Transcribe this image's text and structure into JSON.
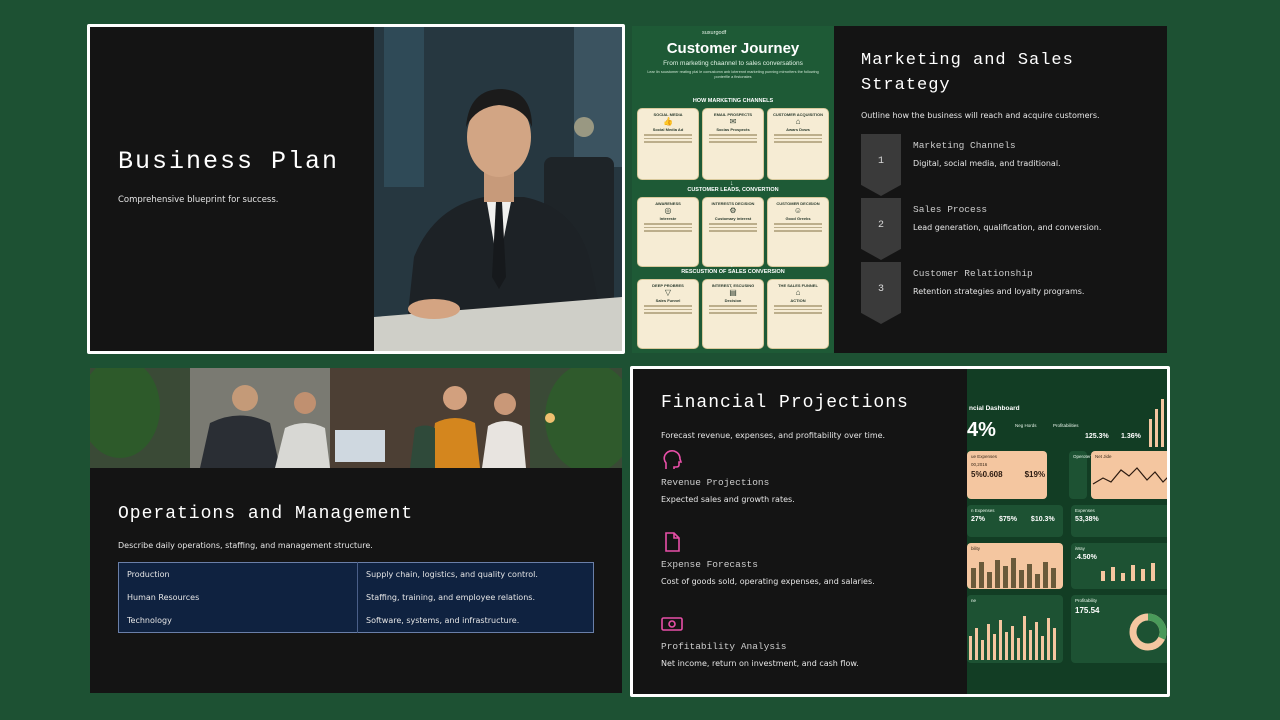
{
  "slide1": {
    "title": "Business Plan",
    "subtitle": "Comprehensive blueprint for success."
  },
  "slide2": {
    "poster": {
      "brand": "suxurgodf",
      "title": "Customer Journey",
      "subtitle": "From marketing chaannel to sales conversations",
      "tiny_text": "Lear lin soustomer reating plai le comustomn anb loterennt marketing punning mirroriters the following ponterfile a firstonstes",
      "tiny_text2": "Tabs the cusocam suaps for instead dable dost sbre lecle.",
      "sections": [
        {
          "heading": "HOW MARKETING CHANNELS",
          "cards": [
            {
              "head": "SOCIAL MEDIA",
              "name": "Social Media Ad"
            },
            {
              "head": "EMAIL PROSPECTS",
              "name": "Socias Prospects"
            },
            {
              "head": "CUSTOMER ACQUISITION",
              "name": "Awars Dows"
            }
          ]
        },
        {
          "heading": "CUSTOMER LEADS, CONVERTION",
          "cards": [
            {
              "head": "AWARENESS",
              "name": "Intereste"
            },
            {
              "head": "INTERESTS DECISION",
              "name": "Customary interest"
            },
            {
              "head": "CUSTOMER DECISION",
              "name": "Good Greeks"
            }
          ]
        },
        {
          "heading": "RESCUSTION OF SALES CONVERSION",
          "cards": [
            {
              "head": "DEEP PROBRES",
              "name": "Sales Funnel"
            },
            {
              "head": "INTEREST, ESCUSING",
              "name": "Decision"
            },
            {
              "head": "THE SALES FUNNEL",
              "name": "ACTION"
            }
          ]
        }
      ]
    },
    "title": "Marketing and Sales Strategy",
    "subtitle": "Outline how the business will reach and acquire customers.",
    "steps": [
      {
        "num": "1",
        "heading": "Marketing Channels",
        "desc": "Digital, social media, and traditional."
      },
      {
        "num": "2",
        "heading": "Sales Process",
        "desc": "Lead generation, qualification, and conversion."
      },
      {
        "num": "3",
        "heading": "Customer Relationship",
        "desc": "Retention strategies and loyalty programs."
      }
    ]
  },
  "slide3": {
    "title": "Operations and Management",
    "subtitle": "Describe daily operations, staffing, and management structure.",
    "rows": [
      {
        "area": "Production",
        "detail": "Supply chain, logistics, and quality control."
      },
      {
        "area": "Human Resources",
        "detail": "Staffing, training, and employee relations."
      },
      {
        "area": "Technology",
        "detail": "Software, systems, and infrastructure."
      }
    ]
  },
  "slide4": {
    "title": "Financial Projections",
    "subtitle": "Forecast revenue, expenses, and profitability over time.",
    "items": [
      {
        "icon": "head-icon",
        "heading": "Revenue Projections",
        "desc": "Expected sales and growth rates."
      },
      {
        "icon": "document-icon",
        "heading": "Expense Forecasts",
        "desc": "Cost of goods sold, operating expenses, and salaries."
      },
      {
        "icon": "money-icon",
        "heading": "Profitability Analysis",
        "desc": "Net income, return on investment, and cash flow."
      }
    ],
    "dashboard": {
      "title": "ncial Dashboard",
      "big_value": "4%",
      "legend": [
        "Neg Hords",
        "Profitabilities"
      ],
      "kpis": [
        "125.3%",
        "1.36%"
      ],
      "panel_labels": [
        "ue Expenses",
        "Operoter",
        "Net Jide",
        "n Expenses",
        "Expenses",
        "bility",
        "iWay",
        "ne",
        "Profitability"
      ],
      "panel_values": [
        "5%0.608",
        "$19%",
        "27%",
        "$75%",
        "$10.3%",
        "53,38%",
        ".4.50%",
        "175.54"
      ],
      "panel_small": [
        "00,2016",
        "5,3000",
        "2.30%",
        "78%",
        "75,7655"
      ]
    },
    "accent": "#e84fa8"
  }
}
